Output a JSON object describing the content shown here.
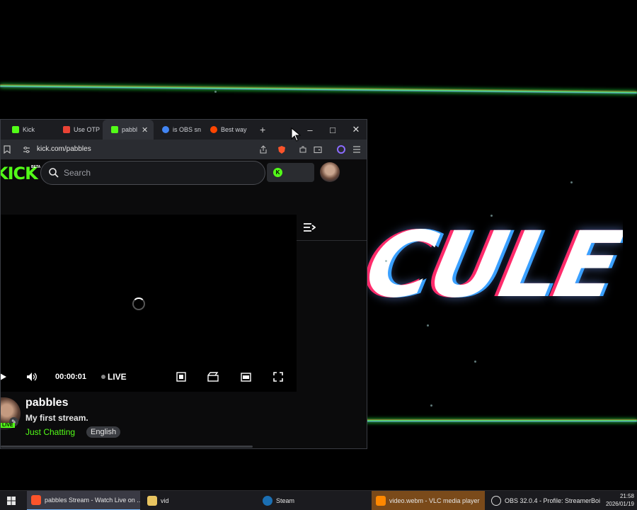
{
  "browser": {
    "tabs": [
      {
        "label": "Kick",
        "favicon_color": "#53fc18"
      },
      {
        "label": "Use OTP",
        "favicon_color": "#ea4335"
      },
      {
        "label": "pabbl",
        "favicon_color": "#53fc18",
        "active": true
      },
      {
        "label": "is OBS sn",
        "favicon_color": "#4285f4"
      },
      {
        "label": "Best way",
        "favicon_color": "#ff4500"
      }
    ],
    "new_tab": "+",
    "minimize": "–",
    "maximize": "□",
    "close": "✕",
    "url": "kick.com/pabbles"
  },
  "kick": {
    "logo": "KICK",
    "beta": "BETA",
    "search_placeholder": "Search",
    "brand_color": "#53fc18"
  },
  "player": {
    "time": "00:00:01",
    "live_label": "LIVE"
  },
  "stream": {
    "streamer": "pabbles",
    "title": "My first stream.",
    "category": "Just Chatting",
    "language": "English",
    "live_badge": "LIVE"
  },
  "background": {
    "overlay_text": "CULE"
  },
  "taskbar": {
    "items": [
      {
        "label": "pabbles Stream - Watch Live on ..."
      },
      {
        "label": "vid"
      },
      {
        "label": "Steam"
      },
      {
        "label": "video.webm - VLC media player"
      },
      {
        "label": "OBS 32.0.4 - Profile: StreamerBoi ..."
      }
    ],
    "time": "21:58",
    "date": "2026/01/19"
  }
}
